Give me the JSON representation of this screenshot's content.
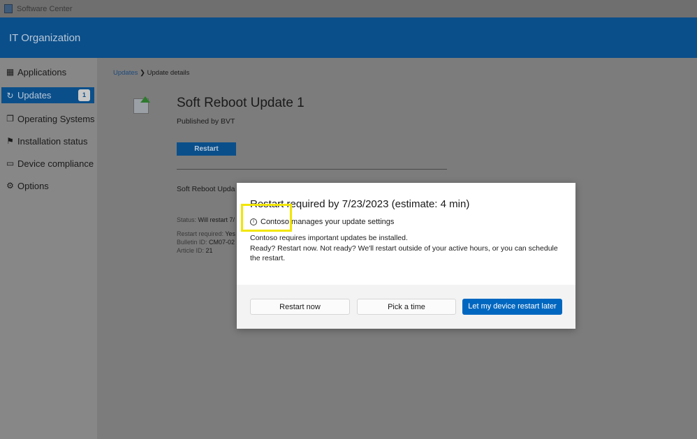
{
  "window": {
    "title": "Software Center"
  },
  "header": {
    "org": "IT Organization"
  },
  "sidebar": {
    "items": [
      {
        "label": "Applications",
        "icon": "grid-icon"
      },
      {
        "label": "Updates",
        "icon": "refresh-icon",
        "badge": "1"
      },
      {
        "label": "Operating Systems",
        "icon": "windows-stack-icon"
      },
      {
        "label": "Installation status",
        "icon": "flag-icon"
      },
      {
        "label": "Device compliance",
        "icon": "device-check-icon"
      },
      {
        "label": "Options",
        "icon": "gear-icon"
      }
    ]
  },
  "breadcrumb": {
    "parent": "Updates",
    "current": "Update details"
  },
  "update": {
    "title": "Soft Reboot Update 1",
    "publisher": "Published by BVT",
    "restart_label": "Restart",
    "subtitle": "Soft Reboot Upda",
    "status_label": "Status:",
    "status_value": "Will restart 7/",
    "restart_required_label": "Restart required:",
    "restart_required_value": "Yes",
    "bulletin_label": "Bulletin ID:",
    "bulletin_value": "CM07-02",
    "article_label": "Article ID:",
    "article_value": "21"
  },
  "dialog": {
    "title": "Restart required by 7/23/2023 (estimate: 4 min)",
    "info": "Contoso manages your update settings",
    "line1": "Contoso requires important updates be installed.",
    "line2": "Ready? Restart now. Not ready? We'll restart outside of your active hours, or you can schedule the restart.",
    "restart_now": "Restart now",
    "pick_time": "Pick a time",
    "restart_later": "Let my device restart later"
  },
  "colors": {
    "accent": "#0067c0",
    "header": "#0b4f8a",
    "highlight": "#f2e600"
  }
}
